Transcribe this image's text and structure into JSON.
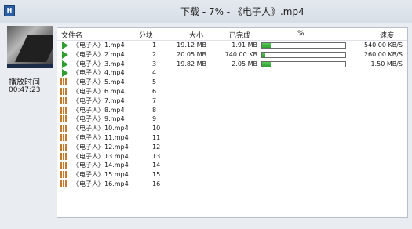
{
  "window": {
    "icon": "app-icon",
    "title": "下载 - 7% - 《电子人》.mp4"
  },
  "side": {
    "play_time_label": "播放时间",
    "play_time": "00:47:23"
  },
  "columns": {
    "name": "文件名",
    "block": "分块",
    "size": "大小",
    "done": "已完成",
    "percent": "%",
    "speed": "速度"
  },
  "rows": [
    {
      "name": "《电子人》1.mp4",
      "block": "1",
      "size": "19.12 MB",
      "done": "1.91 MB",
      "progress": 0.1,
      "speed": "540.00 KB/S",
      "status": "downloading"
    },
    {
      "name": "《电子人》2.mp4",
      "block": "2",
      "size": "20.05 MB",
      "done": "740.00 KB",
      "progress": 0.04,
      "speed": "260.00 KB/S",
      "status": "downloading"
    },
    {
      "name": "《电子人》3.mp4",
      "block": "3",
      "size": "19.82 MB",
      "done": "2.05 MB",
      "progress": 0.1,
      "speed": "1.50 MB/S",
      "status": "downloading"
    },
    {
      "name": "《电子人》4.mp4",
      "block": "4",
      "size": "",
      "done": "",
      "progress": null,
      "speed": "",
      "status": "downloading"
    },
    {
      "name": "《电子人》5.mp4",
      "block": "5",
      "size": "",
      "done": "",
      "progress": null,
      "speed": "",
      "status": "waiting"
    },
    {
      "name": "《电子人》6.mp4",
      "block": "6",
      "size": "",
      "done": "",
      "progress": null,
      "speed": "",
      "status": "waiting"
    },
    {
      "name": "《电子人》7.mp4",
      "block": "7",
      "size": "",
      "done": "",
      "progress": null,
      "speed": "",
      "status": "waiting"
    },
    {
      "name": "《电子人》8.mp4",
      "block": "8",
      "size": "",
      "done": "",
      "progress": null,
      "speed": "",
      "status": "waiting"
    },
    {
      "name": "《电子人》9.mp4",
      "block": "9",
      "size": "",
      "done": "",
      "progress": null,
      "speed": "",
      "status": "waiting"
    },
    {
      "name": "《电子人》10.mp4",
      "block": "10",
      "size": "",
      "done": "",
      "progress": null,
      "speed": "",
      "status": "waiting"
    },
    {
      "name": "《电子人》11.mp4",
      "block": "11",
      "size": "",
      "done": "",
      "progress": null,
      "speed": "",
      "status": "waiting"
    },
    {
      "name": "《电子人》12.mp4",
      "block": "12",
      "size": "",
      "done": "",
      "progress": null,
      "speed": "",
      "status": "waiting"
    },
    {
      "name": "《电子人》13.mp4",
      "block": "13",
      "size": "",
      "done": "",
      "progress": null,
      "speed": "",
      "status": "waiting"
    },
    {
      "name": "《电子人》14.mp4",
      "block": "14",
      "size": "",
      "done": "",
      "progress": null,
      "speed": "",
      "status": "waiting"
    },
    {
      "name": "《电子人》15.mp4",
      "block": "15",
      "size": "",
      "done": "",
      "progress": null,
      "speed": "",
      "status": "waiting"
    },
    {
      "name": "《电子人》16.mp4",
      "block": "16",
      "size": "",
      "done": "",
      "progress": null,
      "speed": "",
      "status": "waiting"
    }
  ],
  "colors": {
    "progress_fill": "#3fb53f",
    "playing_icon": "#2f9e2f",
    "waiting_icon": "#c9792a"
  }
}
